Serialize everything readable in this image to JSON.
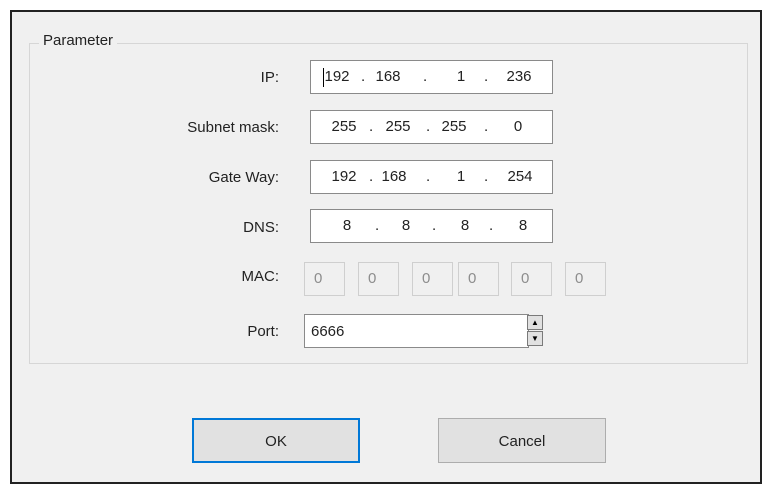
{
  "group": {
    "title": "Parameter"
  },
  "fields": {
    "ip": {
      "label": "IP:",
      "octets": [
        "192",
        "168",
        "1",
        "236"
      ]
    },
    "subnet": {
      "label": "Subnet mask:",
      "octets": [
        "255",
        "255",
        "255",
        "0"
      ]
    },
    "gateway": {
      "label": "Gate Way:",
      "octets": [
        "192",
        "168",
        "1",
        "254"
      ]
    },
    "dns": {
      "label": "DNS:",
      "octets": [
        "8",
        "8",
        "8",
        "8"
      ]
    },
    "mac": {
      "label": "MAC:",
      "values": [
        "0",
        "0",
        "0",
        "0",
        "0",
        "0"
      ]
    },
    "port": {
      "label": "Port:",
      "value": "6666"
    }
  },
  "separator": ".",
  "buttons": {
    "ok": "OK",
    "cancel": "Cancel"
  },
  "colors": {
    "default_button_border": "#0078d7",
    "dialog_bg": "#f0f0f0"
  }
}
